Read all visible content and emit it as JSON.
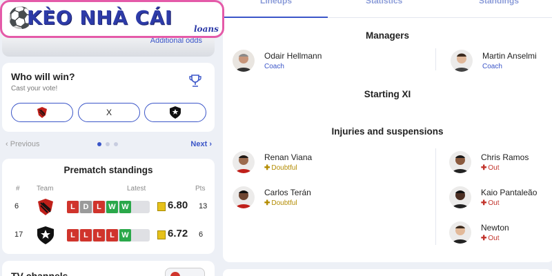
{
  "logo": {
    "title": "KÈO NHÀ CÁI",
    "subtitle": "loans"
  },
  "odds_card": {
    "link": "Additional odds"
  },
  "vote": {
    "question": "Who will win?",
    "subtitle": "Cast your vote!",
    "draw_label": "X"
  },
  "pager": {
    "prev": "Previous",
    "next": "Next"
  },
  "standings": {
    "title": "Prematch standings",
    "col_rank": "#",
    "col_team": "Team",
    "col_latest": "Latest",
    "col_pts": "Pts",
    "rows": [
      {
        "rank": "6",
        "form": [
          "L",
          "D",
          "L",
          "W",
          "W"
        ],
        "rating": "6.80",
        "pts": "13"
      },
      {
        "rank": "17",
        "form": [
          "L",
          "L",
          "L",
          "L",
          "W"
        ],
        "rating": "6.72",
        "pts": "6"
      }
    ]
  },
  "tv_card": {
    "title": "TV channels"
  },
  "tabs": [
    "Lineups",
    "Statistics",
    "Standings"
  ],
  "managers": {
    "title": "Managers",
    "left": {
      "name": "Odair Hellmann",
      "role": "Coach"
    },
    "right": {
      "name": "Martin Anselmi",
      "role": "Coach"
    }
  },
  "starting_xi": {
    "title": "Starting XI"
  },
  "injuries": {
    "title": "Injuries and suspensions",
    "left": [
      {
        "name": "Renan Viana",
        "status": "Doubtful"
      },
      {
        "name": "Carlos Terán",
        "status": "Doubtful"
      }
    ],
    "right": [
      {
        "name": "Chris Ramos",
        "status": "Out"
      },
      {
        "name": "Kaio Pantaleão",
        "status": "Out"
      },
      {
        "name": "Newton",
        "status": "Out"
      }
    ]
  },
  "colors": {
    "accent": "#3a55c8",
    "loss": "#d0342c",
    "win": "#2aa84a",
    "draw": "#9a9a9a",
    "doubtful": "#b38b00",
    "out": "#c2332b",
    "rating": "#e6c11a"
  }
}
